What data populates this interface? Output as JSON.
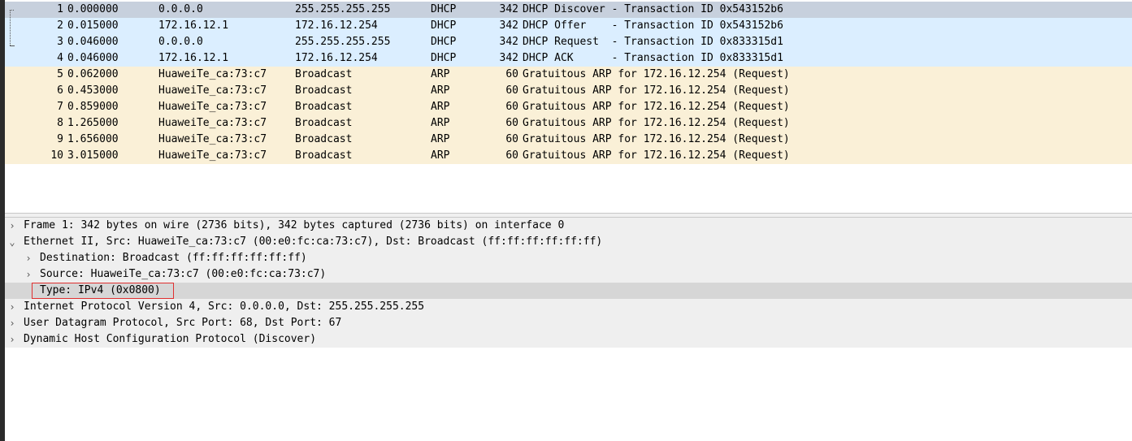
{
  "packet_list": {
    "rows": [
      {
        "no": "1",
        "time": "0.000000",
        "source": "0.0.0.0",
        "destination": "255.255.255.255",
        "protocol": "DHCP",
        "length": "342",
        "info": "DHCP Discover - Transaction ID 0x543152b6",
        "type": "selected"
      },
      {
        "no": "2",
        "time": "0.015000",
        "source": "172.16.12.1",
        "destination": "172.16.12.254",
        "protocol": "DHCP",
        "length": "342",
        "info": "DHCP Offer    - Transaction ID 0x543152b6",
        "type": "dhcp"
      },
      {
        "no": "3",
        "time": "0.046000",
        "source": "0.0.0.0",
        "destination": "255.255.255.255",
        "protocol": "DHCP",
        "length": "342",
        "info": "DHCP Request  - Transaction ID 0x833315d1",
        "type": "dhcp"
      },
      {
        "no": "4",
        "time": "0.046000",
        "source": "172.16.12.1",
        "destination": "172.16.12.254",
        "protocol": "DHCP",
        "length": "342",
        "info": "DHCP ACK      - Transaction ID 0x833315d1",
        "type": "dhcp"
      },
      {
        "no": "5",
        "time": "0.062000",
        "source": "HuaweiTe_ca:73:c7",
        "destination": "Broadcast",
        "protocol": "ARP",
        "length": "60",
        "info": "Gratuitous ARP for 172.16.12.254 (Request)",
        "type": "arp"
      },
      {
        "no": "6",
        "time": "0.453000",
        "source": "HuaweiTe_ca:73:c7",
        "destination": "Broadcast",
        "protocol": "ARP",
        "length": "60",
        "info": "Gratuitous ARP for 172.16.12.254 (Request)",
        "type": "arp"
      },
      {
        "no": "7",
        "time": "0.859000",
        "source": "HuaweiTe_ca:73:c7",
        "destination": "Broadcast",
        "protocol": "ARP",
        "length": "60",
        "info": "Gratuitous ARP for 172.16.12.254 (Request)",
        "type": "arp"
      },
      {
        "no": "8",
        "time": "1.265000",
        "source": "HuaweiTe_ca:73:c7",
        "destination": "Broadcast",
        "protocol": "ARP",
        "length": "60",
        "info": "Gratuitous ARP for 172.16.12.254 (Request)",
        "type": "arp"
      },
      {
        "no": "9",
        "time": "1.656000",
        "source": "HuaweiTe_ca:73:c7",
        "destination": "Broadcast",
        "protocol": "ARP",
        "length": "60",
        "info": "Gratuitous ARP for 172.16.12.254 (Request)",
        "type": "arp"
      },
      {
        "no": "10",
        "time": "3.015000",
        "source": "HuaweiTe_ca:73:c7",
        "destination": "Broadcast",
        "protocol": "ARP",
        "length": "60",
        "info": "Gratuitous ARP for 172.16.12.254 (Request)",
        "type": "arp"
      }
    ]
  },
  "details": {
    "items": [
      {
        "text": "Frame 1: 342 bytes on wire (2736 bits), 342 bytes captured (2736 bits) on interface 0",
        "arrow": "collapsed",
        "indent": 0
      },
      {
        "text": "Ethernet II, Src: HuaweiTe_ca:73:c7 (00:e0:fc:ca:73:c7), Dst: Broadcast (ff:ff:ff:ff:ff:ff)",
        "arrow": "expanded",
        "indent": 0
      },
      {
        "text": "Destination: Broadcast (ff:ff:ff:ff:ff:ff)",
        "arrow": "collapsed",
        "indent": 1
      },
      {
        "text": "Source: HuaweiTe_ca:73:c7 (00:e0:fc:ca:73:c7)",
        "arrow": "collapsed",
        "indent": 1
      },
      {
        "text": "Type: IPv4 (0x0800)",
        "arrow": "none",
        "indent": 1,
        "selected": true
      },
      {
        "text": "Internet Protocol Version 4, Src: 0.0.0.0, Dst: 255.255.255.255",
        "arrow": "collapsed",
        "indent": 0
      },
      {
        "text": "User Datagram Protocol, Src Port: 68, Dst Port: 67",
        "arrow": "collapsed",
        "indent": 0
      },
      {
        "text": "Dynamic Host Configuration Protocol (Discover)",
        "arrow": "collapsed",
        "indent": 0
      }
    ]
  },
  "colors": {
    "selected_row": "#c7d0dd",
    "dhcp_row": "#dbeeff",
    "arp_row": "#faf0d7",
    "highlight_box": "#e03030"
  },
  "icons": {
    "collapsed": "chevron-right-icon",
    "expanded": "chevron-down-icon"
  }
}
